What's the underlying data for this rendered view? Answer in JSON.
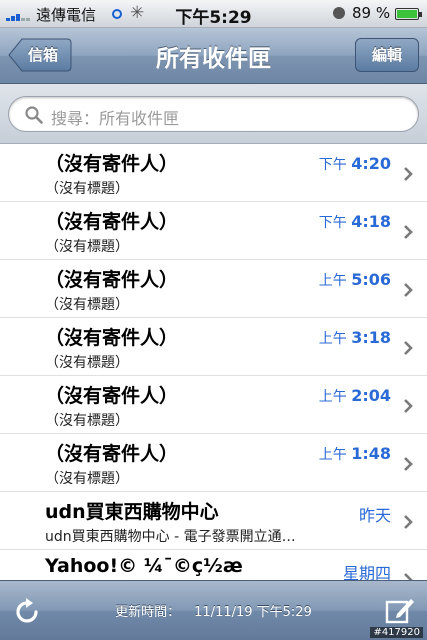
{
  "status_bar": {
    "carrier": "遠傳電信",
    "time": "下午5:29",
    "battery": "89 %"
  },
  "nav": {
    "back_label": "信箱",
    "title": "所有收件匣",
    "edit_label": "編輯"
  },
  "search": {
    "placeholder": "搜尋：所有收件匣"
  },
  "messages": [
    {
      "sender": "（沒有寄件人）",
      "subject": "（沒有標題）",
      "time_prefix": "下午",
      "time": "4:20"
    },
    {
      "sender": "（沒有寄件人）",
      "subject": "（沒有標題）",
      "time_prefix": "下午",
      "time": "4:18"
    },
    {
      "sender": "（沒有寄件人）",
      "subject": "（沒有標題）",
      "time_prefix": "上午",
      "time": "5:06"
    },
    {
      "sender": "（沒有寄件人）",
      "subject": "（沒有標題）",
      "time_prefix": "上午",
      "time": "3:18"
    },
    {
      "sender": "（沒有寄件人）",
      "subject": "（沒有標題）",
      "time_prefix": "上午",
      "time": "2:04"
    },
    {
      "sender": "（沒有寄件人）",
      "subject": "（沒有標題）",
      "time_prefix": "上午",
      "time": "1:48"
    },
    {
      "sender": "udn買東西購物中心",
      "subject": "udn買東西購物中心 - 電子發票開立通…",
      "time_prefix": "",
      "time": "昨天"
    },
    {
      "sender": "Yahoo!© ¼¯©ç½æ",
      "subject": "",
      "time_prefix": "",
      "time": "星期四"
    }
  ],
  "toolbar": {
    "updated_label": "更新時間：",
    "updated_value": "11/11/19 下午5:29"
  },
  "watermark": "#417920",
  "colors": {
    "accent": "#2a6ad6",
    "battery": "#3cc23a"
  }
}
